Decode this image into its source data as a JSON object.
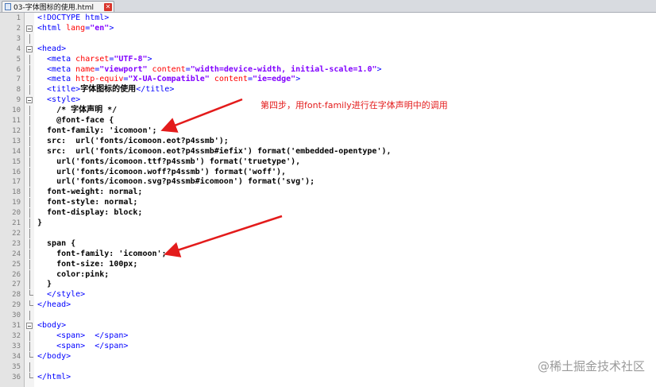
{
  "tab": {
    "title": "03-字体图标的使用.html"
  },
  "lines": [
    {
      "n": "1",
      "fold": "",
      "parts": [
        {
          "c": "tag",
          "t": "<!DOCTYPE html>"
        }
      ]
    },
    {
      "n": "2",
      "fold": "open",
      "parts": [
        {
          "c": "tag",
          "t": "<html "
        },
        {
          "c": "attr",
          "t": "lang"
        },
        {
          "c": "tag",
          "t": "="
        },
        {
          "c": "val",
          "t": "\"en\""
        },
        {
          "c": "tag",
          "t": ">"
        }
      ]
    },
    {
      "n": "3",
      "fold": "vline",
      "parts": []
    },
    {
      "n": "4",
      "fold": "open",
      "parts": [
        {
          "c": "tag",
          "t": "<head>"
        }
      ]
    },
    {
      "n": "5",
      "fold": "vline",
      "parts": [
        {
          "c": "tag",
          "t": "  <meta "
        },
        {
          "c": "attr",
          "t": "charset"
        },
        {
          "c": "tag",
          "t": "="
        },
        {
          "c": "val",
          "t": "\"UTF-8\""
        },
        {
          "c": "tag",
          "t": ">"
        }
      ]
    },
    {
      "n": "6",
      "fold": "vline",
      "parts": [
        {
          "c": "tag",
          "t": "  <meta "
        },
        {
          "c": "attr",
          "t": "name"
        },
        {
          "c": "tag",
          "t": "="
        },
        {
          "c": "val",
          "t": "\"viewport\""
        },
        {
          "c": "tag",
          "t": " "
        },
        {
          "c": "attr",
          "t": "content"
        },
        {
          "c": "tag",
          "t": "="
        },
        {
          "c": "val",
          "t": "\"width=device-width, initial-scale=1.0\""
        },
        {
          "c": "tag",
          "t": ">"
        }
      ]
    },
    {
      "n": "7",
      "fold": "vline",
      "parts": [
        {
          "c": "tag",
          "t": "  <meta "
        },
        {
          "c": "attr",
          "t": "http-equiv"
        },
        {
          "c": "tag",
          "t": "="
        },
        {
          "c": "val",
          "t": "\"X-UA-Compatible\""
        },
        {
          "c": "tag",
          "t": " "
        },
        {
          "c": "attr",
          "t": "content"
        },
        {
          "c": "tag",
          "t": "="
        },
        {
          "c": "val",
          "t": "\"ie=edge\""
        },
        {
          "c": "tag",
          "t": ">"
        }
      ]
    },
    {
      "n": "8",
      "fold": "vline",
      "parts": [
        {
          "c": "tag",
          "t": "  <title>"
        },
        {
          "c": "txt",
          "t": "字体图标的使用"
        },
        {
          "c": "tag",
          "t": "</title>"
        }
      ]
    },
    {
      "n": "9",
      "fold": "open",
      "parts": [
        {
          "c": "tag",
          "t": "  <style>"
        }
      ]
    },
    {
      "n": "10",
      "fold": "vline",
      "parts": [
        {
          "c": "txt",
          "t": "    /* 字体声明 */"
        }
      ]
    },
    {
      "n": "11",
      "fold": "vline",
      "parts": [
        {
          "c": "txt",
          "t": "    @font-face {"
        }
      ]
    },
    {
      "n": "12",
      "fold": "vline",
      "parts": [
        {
          "c": "txt",
          "t": "  font-family: 'icomoon';"
        }
      ]
    },
    {
      "n": "13",
      "fold": "vline",
      "parts": [
        {
          "c": "txt",
          "t": "  src:  url('fonts/icomoon.eot?p4ssmb');"
        }
      ]
    },
    {
      "n": "14",
      "fold": "vline",
      "parts": [
        {
          "c": "txt",
          "t": "  src:  url('fonts/icomoon.eot?p4ssmb#iefix') format('embedded-opentype'),"
        }
      ]
    },
    {
      "n": "15",
      "fold": "vline",
      "parts": [
        {
          "c": "txt",
          "t": "    url('fonts/icomoon.ttf?p4ssmb') format('truetype'),"
        }
      ]
    },
    {
      "n": "16",
      "fold": "vline",
      "parts": [
        {
          "c": "txt",
          "t": "    url('fonts/icomoon.woff?p4ssmb') format('woff'),"
        }
      ]
    },
    {
      "n": "17",
      "fold": "vline",
      "parts": [
        {
          "c": "txt",
          "t": "    url('fonts/icomoon.svg?p4ssmb#icomoon') format('svg');"
        }
      ]
    },
    {
      "n": "18",
      "fold": "vline",
      "parts": [
        {
          "c": "txt",
          "t": "  font-weight: normal;"
        }
      ]
    },
    {
      "n": "19",
      "fold": "vline",
      "parts": [
        {
          "c": "txt",
          "t": "  font-style: normal;"
        }
      ]
    },
    {
      "n": "20",
      "fold": "vline",
      "parts": [
        {
          "c": "txt",
          "t": "  font-display: block;"
        }
      ]
    },
    {
      "n": "21",
      "fold": "vline",
      "parts": [
        {
          "c": "txt",
          "t": "}"
        }
      ]
    },
    {
      "n": "22",
      "fold": "vline",
      "parts": []
    },
    {
      "n": "23",
      "fold": "vline",
      "parts": [
        {
          "c": "txt",
          "t": "  span {"
        }
      ]
    },
    {
      "n": "24",
      "fold": "vline",
      "parts": [
        {
          "c": "txt",
          "t": "    font-family: 'icomoon';"
        }
      ]
    },
    {
      "n": "25",
      "fold": "vline",
      "parts": [
        {
          "c": "txt",
          "t": "    font-size: 100px;"
        }
      ]
    },
    {
      "n": "26",
      "fold": "vline",
      "parts": [
        {
          "c": "txt",
          "t": "    color:pink;"
        }
      ]
    },
    {
      "n": "27",
      "fold": "vline",
      "parts": [
        {
          "c": "txt",
          "t": "  }"
        }
      ]
    },
    {
      "n": "28",
      "fold": "end",
      "parts": [
        {
          "c": "tag",
          "t": "  </style>"
        }
      ]
    },
    {
      "n": "29",
      "fold": "end",
      "parts": [
        {
          "c": "tag",
          "t": "</head>"
        }
      ]
    },
    {
      "n": "30",
      "fold": "vline",
      "parts": []
    },
    {
      "n": "31",
      "fold": "open",
      "parts": [
        {
          "c": "tag",
          "t": "<body>"
        }
      ]
    },
    {
      "n": "32",
      "fold": "vline",
      "parts": [
        {
          "c": "tag",
          "t": "    <span>  </span>"
        }
      ]
    },
    {
      "n": "33",
      "fold": "vline",
      "parts": [
        {
          "c": "tag",
          "t": "    <span>  </span>"
        }
      ]
    },
    {
      "n": "34",
      "fold": "end",
      "parts": [
        {
          "c": "tag",
          "t": "</body>"
        }
      ]
    },
    {
      "n": "35",
      "fold": "vline",
      "parts": []
    },
    {
      "n": "36",
      "fold": "end",
      "parts": [
        {
          "c": "tag",
          "t": "</html>"
        }
      ]
    }
  ],
  "annotation": "第四步，用font-family进行在字体声明中的调用",
  "watermark": "@稀土掘金技术社区",
  "colors": {
    "annotation": "#e31b1b",
    "tag": "#0000ff",
    "attr": "#ff0000",
    "value": "#8000ff"
  }
}
